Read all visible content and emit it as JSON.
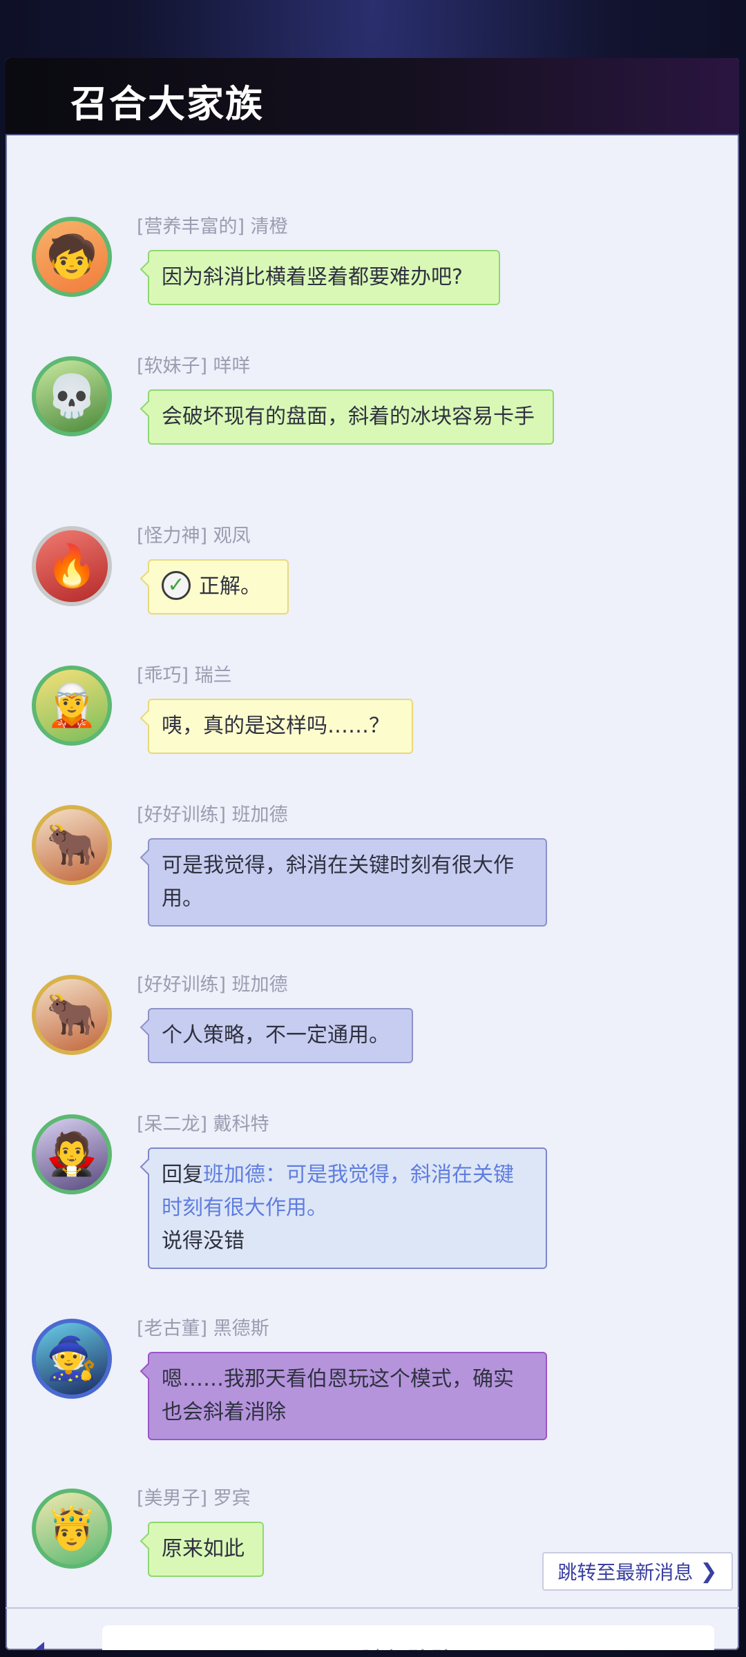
{
  "window": {
    "title": "召合大家族"
  },
  "messages": [
    {
      "sender": "[营养丰富的] 清橙",
      "text": "因为斜消比横着竖着都要难办吧?",
      "color": "#d9f8b6",
      "avatar": "orange-haired-girl-avatar"
    },
    {
      "sender": "[软妹子] 咩咩",
      "text": "会破坏现有的盘面，斜着的冰块容易卡手",
      "color": "#d9f8b6",
      "avatar": "green-haired-skull-hat-avatar"
    },
    {
      "sender": "[怪力神] 观凤",
      "text": "正解。",
      "color": "#fdfccd",
      "avatar": "red-haired-warrior-avatar",
      "icon": "checkmark-icon"
    },
    {
      "sender": "[乖巧] 瑞兰",
      "text": "咦，真的是这样吗……？",
      "color": "#fdfccd",
      "avatar": "blonde-elf-avatar"
    },
    {
      "sender": "[好好训练] 班加德",
      "text": "可是我觉得，斜消在关键时刻有很大作用。",
      "color": "#c7cdf0",
      "avatar": "horned-beast-avatar"
    },
    {
      "sender": "[好好训练] 班加德",
      "text": "个人策略，不一定通用。",
      "color": "#c7cdf0",
      "avatar": "horned-beast-avatar"
    },
    {
      "sender": "[呆二龙] 戴科特",
      "reply_prefix": "回复",
      "reply_name": "班加德",
      "reply_text": "：可是我觉得，斜消在关键时刻有很大作用。",
      "text": "说得没错",
      "color": "#dde6f6",
      "avatar": "dark-haired-elf-avatar"
    },
    {
      "sender": "[老古董] 黑德斯",
      "text": "嗯……我那天看伯恩玩这个模式，确实也会斜着消除",
      "color": "#b594dc",
      "avatar": "dark-mage-avatar"
    },
    {
      "sender": "[美男子] 罗宾",
      "text": "原来如此",
      "color": "#d9f8b6",
      "avatar": "golden-crowned-elf-avatar"
    }
  ],
  "jump_button": {
    "label": "跳转至最新消息"
  },
  "input": {
    "placeholder": "随便聊聊"
  }
}
